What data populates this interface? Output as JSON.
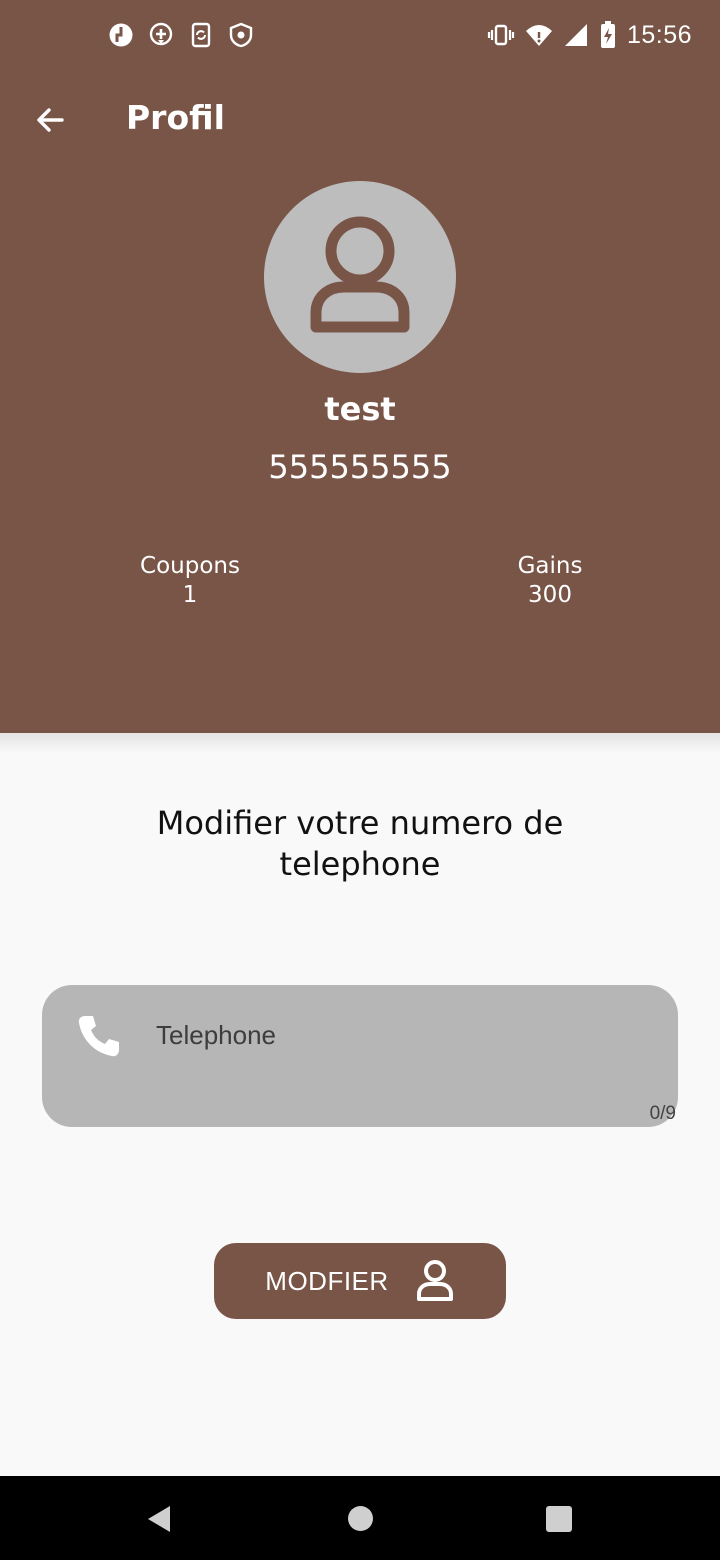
{
  "status_bar": {
    "time": "15:56",
    "left_icons": [
      "app-icon-1",
      "location-plus-icon",
      "sync-icon",
      "shield-icon"
    ],
    "right_icons": [
      "vibrate-icon",
      "wifi-icon",
      "signal-icon",
      "battery-charging-icon"
    ]
  },
  "app_bar": {
    "title": "Profil",
    "back_icon": "arrow-left-icon"
  },
  "profile": {
    "avatar_icon": "user-icon",
    "name": "test",
    "phone": "555555555"
  },
  "stats": {
    "coupons_label": "Coupons",
    "coupons_value": "1",
    "gains_label": "Gains",
    "gains_value": "300"
  },
  "form": {
    "title": "Modifier votre numero de telephone",
    "phone_label": "Telephone",
    "phone_counter": "0/9",
    "phone_icon": "phone-icon",
    "submit_label": "MODFIER",
    "submit_icon": "user-icon"
  },
  "colors": {
    "primary": "#795548",
    "avatar_bg": "#bdbdbd",
    "field_bg": "#b6b6b6",
    "background": "#f9f9f9"
  },
  "nav_bar": {
    "icons": [
      "back-triangle-icon",
      "home-circle-icon",
      "recent-square-icon"
    ]
  }
}
